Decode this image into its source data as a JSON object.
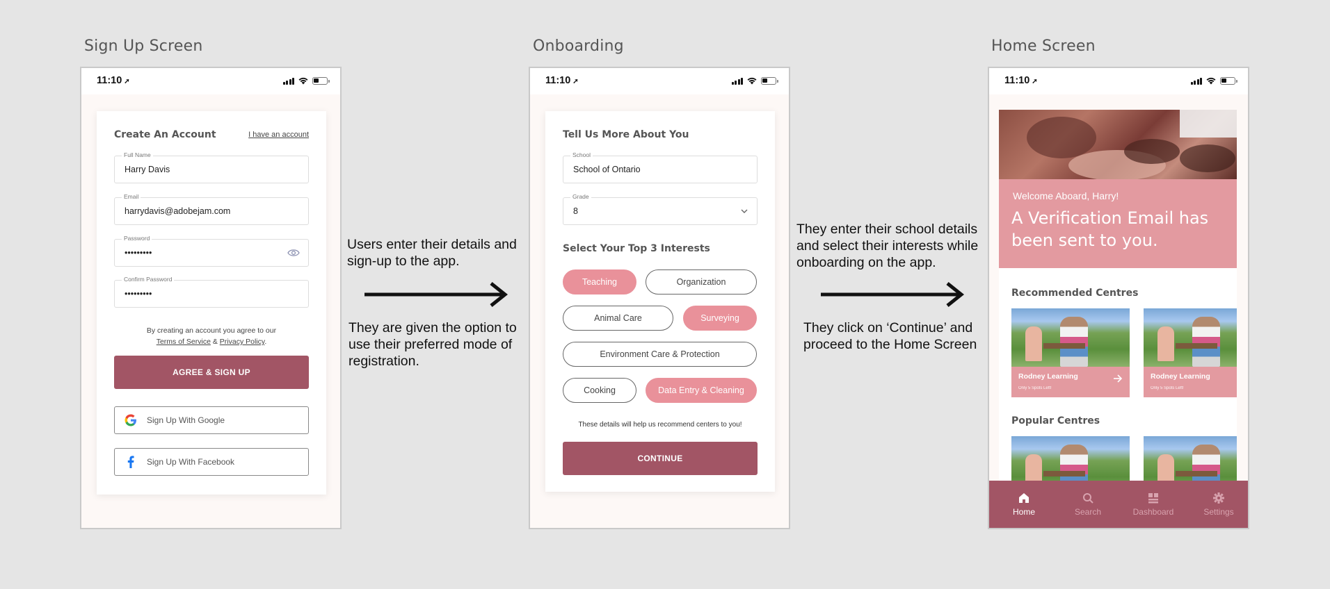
{
  "screens": {
    "signup": {
      "title": "Sign Up Screen"
    },
    "onboarding": {
      "title": "Onboarding"
    },
    "home": {
      "title": "Home Screen"
    }
  },
  "status_bar": {
    "time": "11:10"
  },
  "signup": {
    "heading": "Create An Account",
    "have_account_link": "I have an account",
    "fields": {
      "full_name": {
        "label": "Full Name",
        "value": "Harry Davis"
      },
      "email": {
        "label": "Email",
        "value": "harrydavis@adobejam.com"
      },
      "password": {
        "label": "Password",
        "value": "•••••••••"
      },
      "confirm_password": {
        "label": "Confirm Password",
        "value": "•••••••••"
      }
    },
    "terms_intro": "By creating an account you agree to our",
    "terms_link": "Terms of Service",
    "terms_and": "&",
    "privacy_link": "Privacy Policy",
    "terms_end": ".",
    "submit_label": "AGREE & SIGN UP",
    "google_label": "Sign Up With Google",
    "facebook_label": "Sign Up With Facebook"
  },
  "onboarding": {
    "heading": "Tell Us More About You",
    "school": {
      "label": "School",
      "value": "School of Ontario"
    },
    "grade": {
      "label": "Grade",
      "value": "8"
    },
    "interests_heading": "Select Your Top 3 Interests",
    "interests": [
      {
        "label": "Teaching",
        "selected": true
      },
      {
        "label": "Organization",
        "selected": false
      },
      {
        "label": "Animal Care",
        "selected": false
      },
      {
        "label": "Surveying",
        "selected": true
      },
      {
        "label": "Environment Care & Protection",
        "selected": false
      },
      {
        "label": "Cooking",
        "selected": false
      },
      {
        "label": "Data Entry & Cleaning",
        "selected": true
      }
    ],
    "hint": "These details will help us recommend centers to you!",
    "continue_label": "CONTINUE"
  },
  "home": {
    "welcome": "Welcome Aboard, Harry!",
    "headline": "A Verification Email has been sent to you.",
    "recommended_heading": "Recommended Centres",
    "popular_heading": "Popular Centres",
    "centres": [
      {
        "name": "Rodney Learning",
        "spots": "Only 5 Spots Left!"
      },
      {
        "name": "Rodney Learning",
        "spots": "Only 5 Spots Left!"
      }
    ],
    "tabs": [
      {
        "label": "Home",
        "icon": "home-icon",
        "active": true
      },
      {
        "label": "Search",
        "icon": "search-icon",
        "active": false
      },
      {
        "label": "Dashboard",
        "icon": "dashboard-icon",
        "active": false
      },
      {
        "label": "Settings",
        "icon": "gear-icon",
        "active": false
      }
    ]
  },
  "annotations": {
    "signup_top": "Users enter their details and sign-up to the app.",
    "signup_bottom": "They are given the option to use their preferred mode of registration.",
    "onboarding_top": "They enter their school details and select their interests while onboarding on the app.",
    "onboarding_bottom": "They click on ‘Continue’ and proceed to the Home Screen"
  },
  "colors": {
    "background": "#e5e5e5",
    "primary": "#a25565",
    "accent_pink": "#e9919a",
    "hero_pink": "#e39aa0"
  }
}
